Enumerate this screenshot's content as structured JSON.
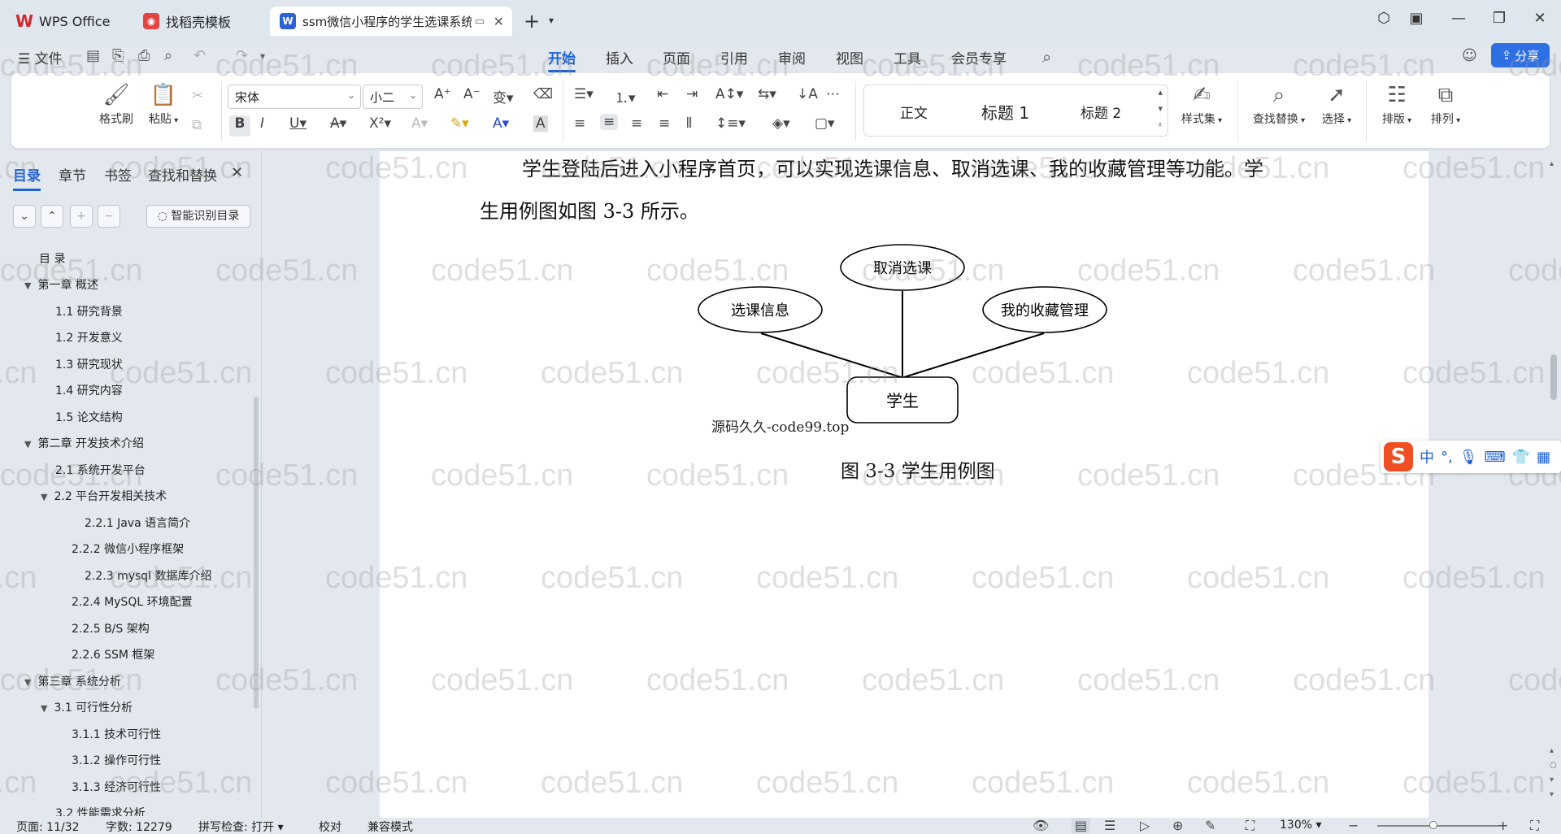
{
  "tabs": [
    {
      "label": "WPS Office"
    },
    {
      "label": "找稻壳模板"
    },
    {
      "label": "ssm微信小程序的学生选课系统"
    }
  ],
  "menu": {
    "file": "文件",
    "items": [
      "开始",
      "插入",
      "页面",
      "引用",
      "审阅",
      "视图",
      "工具",
      "会员专享"
    ],
    "active": "开始",
    "share": "分享"
  },
  "ribbon": {
    "format_painter": "格式刷",
    "paste": "粘贴",
    "font_name": "宋体",
    "font_size": "小二",
    "styles": [
      "正文",
      "标题 1",
      "标题 2"
    ],
    "style_set": "样式集",
    "find_replace": "查找替换",
    "select": "选择",
    "layout": "排版",
    "arrange": "排列"
  },
  "nav": {
    "tabs": [
      "目录",
      "章节",
      "书签",
      "查找和替换"
    ],
    "smart_toc": "智能识别目录",
    "toc": [
      {
        "text": "目  录"
      },
      {
        "text": "第一章  概述"
      },
      {
        "text": "1.1  研究背景"
      },
      {
        "text": "1.2  开发意义"
      },
      {
        "text": "1.3  研究现状"
      },
      {
        "text": "1.4  研究内容"
      },
      {
        "text": "1.5  论文结构"
      },
      {
        "text": "第二章  开发技术介绍"
      },
      {
        "text": "2.1  系统开发平台"
      },
      {
        "text": "2.2  平台开发相关技术"
      },
      {
        "text": "2.2.1   Java 语言简介"
      },
      {
        "text": "2.2.2   微信小程序框架"
      },
      {
        "text": "2.2.3   mysql 数据库介绍"
      },
      {
        "text": "2.2.4   MySQL 环境配置"
      },
      {
        "text": "2.2.5   B/S 架构"
      },
      {
        "text": "2.2.6   SSM 框架"
      },
      {
        "text": "第三章  系统分析"
      },
      {
        "text": "3.1  可行性分析"
      },
      {
        "text": "3.1.1  技术可行性"
      },
      {
        "text": "3.1.2  操作可行性"
      },
      {
        "text": "3.1.3  经济可行性"
      },
      {
        "text": "3.2 性能需求分析"
      }
    ]
  },
  "doc": {
    "para_line1": "学生登陆后进入小程序首页，可以实现选课信息、取消选课、我的收藏管理等功能。学",
    "para_line2": "生用例图如图 3-3 所示。",
    "diagram": {
      "actor": "学生",
      "usecases": [
        "选课信息",
        "取消选课",
        "我的收藏管理"
      ]
    },
    "source_mark": "源码久久-code99.top",
    "caption": "图 3-3 学生用例图"
  },
  "watermark": "code51.cn",
  "ime": {
    "lang": "中"
  },
  "status": {
    "page": "页面: 11/32",
    "words": "字数: 12279",
    "spell": "拼写检查: 打开",
    "proof": "校对",
    "compat": "兼容模式",
    "zoom": "130%"
  }
}
